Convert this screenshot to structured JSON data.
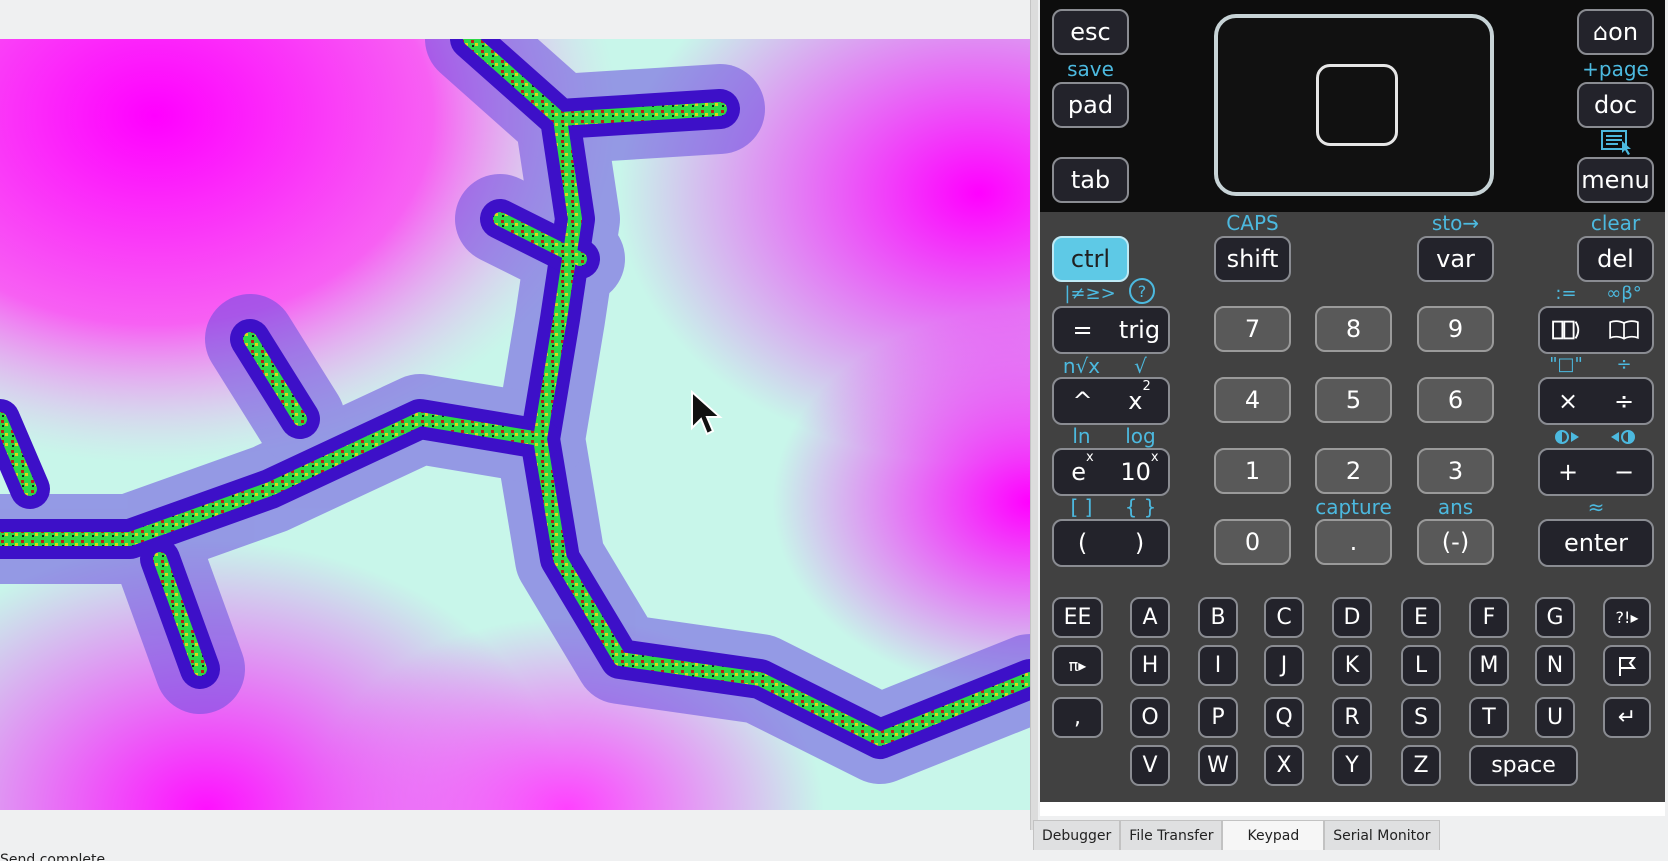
{
  "keypad": {
    "top_keys": {
      "esc": "esc",
      "pad": "pad",
      "tab": "tab",
      "on": "⌂on",
      "doc": "doc",
      "menu": "menu",
      "save_label": "save",
      "page_label": "+page"
    },
    "modifiers": {
      "ctrl": "ctrl",
      "shift": "shift",
      "var": "var",
      "del": "del",
      "caps_label": "CAPS",
      "sto_label": "sto→",
      "clear_label": "clear"
    },
    "func_keys": {
      "eq": "=",
      "trig": "trig",
      "pow": "^",
      "x2_base": "x",
      "x2_sup": "2",
      "ex_base": "e",
      "ex_sup": "x",
      "tenx_base": "10",
      "tenx_sup": "x",
      "lparen": "(",
      "rparen": ")",
      "neq_label": "|≠≥>",
      "help_label": "?",
      "nroot_label": "n√x",
      "sqrt_label": "√",
      "ln_label": "ln",
      "log_label": "log",
      "brackets_label": "[ ]",
      "braces_label": "{ }"
    },
    "digits": [
      "7",
      "8",
      "9",
      "4",
      "5",
      "6",
      "1",
      "2",
      "3",
      "0",
      ".",
      "(-)"
    ],
    "digit_labels": {
      "capture": "capture",
      "ans": "ans"
    },
    "ops": {
      "times": "×",
      "divide": "÷",
      "plus": "+",
      "minus": "−",
      "enter": "enter",
      "define_label": ":=",
      "symbols_label": "∞β°",
      "quote_label": "\"□\"",
      "frac_label": "÷",
      "approx_label": "≈"
    },
    "alpha_row1": [
      "EE",
      "A",
      "B",
      "C",
      "D",
      "E",
      "F",
      "G",
      "?!▸"
    ],
    "alpha_row2": [
      "π▸",
      "H",
      "I",
      "J",
      "K",
      "L",
      "M",
      "N"
    ],
    "alpha_row3": [
      ",",
      "O",
      "P",
      "Q",
      "R",
      "S",
      "T",
      "U",
      "↵"
    ],
    "alpha_row4": [
      "V",
      "W",
      "X",
      "Y",
      "Z",
      "space"
    ]
  },
  "tabs": [
    "Debugger",
    "File Transfer",
    "Keypad",
    "Serial Monitor"
  ],
  "active_tab": "Keypad",
  "status_text": "Send complete",
  "colors": {
    "accent": "#4cb9df",
    "key_bg": "#23232b",
    "num_key_bg": "#595959",
    "ctrl_bg": "#5ec9e6",
    "fractal_magenta": "#ff00ff",
    "fractal_mint": "#bff7e6",
    "fractal_purple": "#3d10c8"
  },
  "icons": {
    "cursor": "mouse-pointer-icon",
    "catalog": "catalog-icon",
    "book": "book-icon",
    "doc_menu": "document-menu-icon",
    "flag": "flag-icon",
    "return": "return-icon",
    "help": "help-circle-icon"
  }
}
